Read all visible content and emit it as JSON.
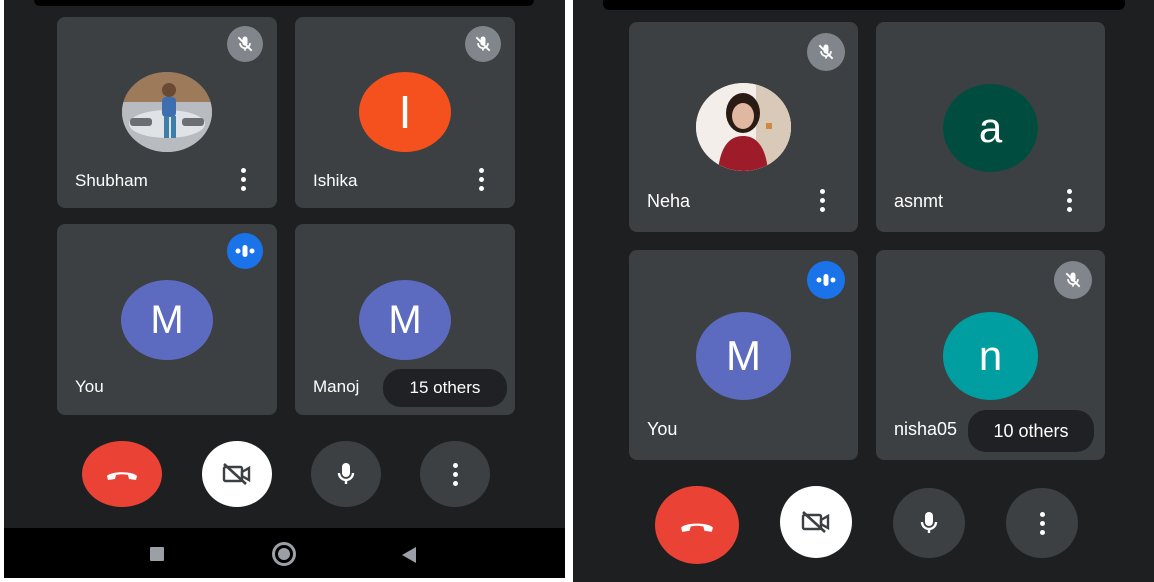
{
  "left": {
    "tiles": [
      {
        "name": "Shubham",
        "avatar_type": "photo",
        "status": "muted"
      },
      {
        "name": "Ishika",
        "avatar_letter": "I",
        "avatar_color": "#f4511e",
        "status": "muted"
      },
      {
        "name": "You",
        "avatar_letter": "M",
        "avatar_color": "#5c6bc0",
        "status": "speaking"
      },
      {
        "name": "Manoj",
        "avatar_letter": "M",
        "avatar_color": "#5c6bc0",
        "others_label": "15 others"
      }
    ],
    "controls": [
      "end-call",
      "camera-off",
      "microphone",
      "more-options"
    ],
    "nav": [
      "recents",
      "home",
      "back"
    ]
  },
  "right": {
    "tiles": [
      {
        "name": "Neha",
        "avatar_type": "photo",
        "status": "muted"
      },
      {
        "name": "asnmt",
        "avatar_letter": "a",
        "avatar_color": "#004d40"
      },
      {
        "name": "You",
        "avatar_letter": "M",
        "avatar_color": "#5c6bc0",
        "status": "speaking"
      },
      {
        "name": "nisha05",
        "avatar_letter": "n",
        "avatar_color": "#009ea0",
        "status": "muted",
        "others_label": "10 others"
      }
    ],
    "controls": [
      "end-call",
      "camera-off",
      "microphone",
      "more-options"
    ]
  },
  "colors": {
    "background": "#1e1f21",
    "tile": "#3c4043",
    "end_call": "#ea4335",
    "speaking_badge": "#1a73e8",
    "mute_badge": "#80868b"
  }
}
